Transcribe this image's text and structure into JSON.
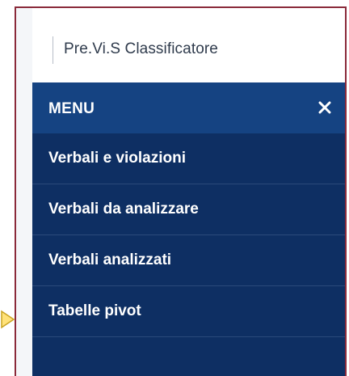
{
  "app": {
    "title": "Pre.Vi.S Classificatore"
  },
  "menu": {
    "label": "MENU",
    "close_icon": "close-icon",
    "items": [
      {
        "label": "Verbali e violazioni"
      },
      {
        "label": "Verbali da analizzare"
      },
      {
        "label": "Verbali analizzati"
      },
      {
        "label": "Tabelle pivot"
      }
    ]
  },
  "colors": {
    "menu_header": "#154382",
    "menu_background": "#0e2f63",
    "frame_border": "#8a2a3a",
    "pointer_fill": "#ffe27a"
  }
}
